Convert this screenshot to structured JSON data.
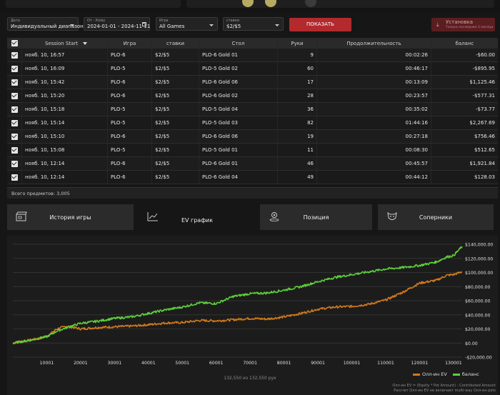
{
  "colors": {
    "ev": "#d17a1a",
    "balance": "#5ed03a",
    "accent_red": "#b22a2d"
  },
  "filters": {
    "date": {
      "label": "Дата",
      "value": "Индивидуальный диапазон"
    },
    "range": {
      "label": "От - Кому",
      "value": "2024-01-01 - 2024-11-11"
    },
    "game": {
      "label": "Игра",
      "value": "All Games"
    },
    "stakes": {
      "label": "ставки",
      "value": "$2/$5"
    },
    "show_button": "ПОКАЗАТЬ",
    "install_button": {
      "title": "Установка",
      "subtitle": "Только последние 3 месяца"
    }
  },
  "table": {
    "headers": [
      "Session Start",
      "Игра",
      "ставки",
      "Стол",
      "Руки",
      "Продолжительность",
      "баланс"
    ],
    "rows": [
      [
        "нояб. 10, 16:57",
        "PLO-6",
        "$2/$5",
        "PLO-6 Gold 01",
        "9",
        "00:02:26",
        "-$60.00"
      ],
      [
        "нояб. 10, 16:09",
        "PLO-5",
        "$2/$5",
        "PLO-5 Gold 02",
        "60",
        "00:46:17",
        "-$895.95"
      ],
      [
        "нояб. 10, 15:42",
        "PLO-6",
        "$2/$5",
        "PLO-6 Gold 06",
        "17",
        "00:13:09",
        "$1,125.46"
      ],
      [
        "нояб. 10, 15:20",
        "PLO-6",
        "$2/$5",
        "PLO-6 Gold 02",
        "28",
        "00:23:57",
        "-$577.31"
      ],
      [
        "нояб. 10, 15:18",
        "PLO-5",
        "$2/$5",
        "PLO-5 Gold 04",
        "36",
        "00:35:02",
        "-$73.77"
      ],
      [
        "нояб. 10, 15:14",
        "PLO-5",
        "$2/$5",
        "PLO-5 Gold 03",
        "82",
        "01:44:16",
        "$2,267.69"
      ],
      [
        "нояб. 10, 15:10",
        "PLO-6",
        "$2/$5",
        "PLO-6 Gold 06",
        "19",
        "00:27:18",
        "$756.46"
      ],
      [
        "нояб. 10, 15:08",
        "PLO-5",
        "$2/$5",
        "PLO-5 Gold 01",
        "11",
        "00:08:30",
        "$512.65"
      ],
      [
        "нояб. 10, 12:14",
        "PLO-6",
        "$2/$5",
        "PLO-6 Gold 01",
        "46",
        "00:45:57",
        "$1,921.84"
      ],
      [
        "нояб. 10, 12:14",
        "PLO-6",
        "$2/$5",
        "PLO-6 Gold 04",
        "49",
        "00:44:12",
        "$128.03"
      ]
    ],
    "total": "Всего предметов: 3,005"
  },
  "tabs": [
    {
      "label": "История игры",
      "icon": "clapperboard-icon"
    },
    {
      "label": "EV график",
      "icon": "line-chart-icon",
      "active": true
    },
    {
      "label": "Позиция",
      "icon": "position-pin-icon"
    },
    {
      "label": "Соперники",
      "icon": "opponent-face-icon"
    }
  ],
  "chart_data": {
    "type": "line",
    "x_range": [
      1,
      132550
    ],
    "x_ticks": [
      10001,
      20001,
      30001,
      40001,
      50001,
      60001,
      70001,
      80001,
      90001,
      100001,
      110001,
      120001,
      130001
    ],
    "ylim": [
      -20000,
      140000
    ],
    "y_ticks": [
      -20000,
      0,
      20000,
      40000,
      60000,
      80000,
      100000,
      120000,
      140000
    ],
    "y_tick_labels": [
      "-$20,000.00",
      "$0.00",
      "$20,000.00",
      "$40,000.00",
      "$60,000.00",
      "$80,000.00",
      "$100,000.00",
      "$120,000.00",
      "$140,000.00"
    ],
    "grid": true,
    "legend_position": "bottom-right",
    "series": [
      {
        "name": "Олл-ин EV",
        "color": "#d17a1a",
        "points": [
          [
            1,
            0
          ],
          [
            5000,
            4000
          ],
          [
            10000,
            9000
          ],
          [
            13000,
            20000
          ],
          [
            16000,
            24000
          ],
          [
            20000,
            20000
          ],
          [
            25000,
            22000
          ],
          [
            30000,
            23000
          ],
          [
            35000,
            24000
          ],
          [
            40000,
            26000
          ],
          [
            45000,
            28500
          ],
          [
            50000,
            29000
          ],
          [
            55000,
            32000
          ],
          [
            60000,
            31500
          ],
          [
            65000,
            33000
          ],
          [
            70000,
            35000
          ],
          [
            75000,
            34000
          ],
          [
            80000,
            37000
          ],
          [
            85000,
            42000
          ],
          [
            90000,
            48000
          ],
          [
            95000,
            51000
          ],
          [
            100000,
            52000
          ],
          [
            105000,
            55000
          ],
          [
            110000,
            61000
          ],
          [
            115000,
            72000
          ],
          [
            120000,
            85000
          ],
          [
            125000,
            89000
          ],
          [
            128000,
            96000
          ],
          [
            130000,
            97000
          ],
          [
            132550,
            101000
          ]
        ]
      },
      {
        "name": "баланс",
        "color": "#5ed03a",
        "points": [
          [
            1,
            0
          ],
          [
            5000,
            4000
          ],
          [
            10000,
            9000
          ],
          [
            13000,
            17000
          ],
          [
            16000,
            22000
          ],
          [
            20000,
            28000
          ],
          [
            25000,
            31000
          ],
          [
            30000,
            35000
          ],
          [
            35000,
            37000
          ],
          [
            40000,
            42000
          ],
          [
            45000,
            47000
          ],
          [
            50000,
            51000
          ],
          [
            55000,
            57000
          ],
          [
            60000,
            56000
          ],
          [
            65000,
            66000
          ],
          [
            70000,
            70000
          ],
          [
            75000,
            71000
          ],
          [
            80000,
            75000
          ],
          [
            85000,
            80000
          ],
          [
            90000,
            87000
          ],
          [
            95000,
            93000
          ],
          [
            100000,
            97000
          ],
          [
            105000,
            101000
          ],
          [
            110000,
            105000
          ],
          [
            115000,
            107000
          ],
          [
            120000,
            110000
          ],
          [
            125000,
            115000
          ],
          [
            128000,
            122000
          ],
          [
            130000,
            124000
          ],
          [
            132550,
            137000
          ]
        ]
      }
    ]
  },
  "chart_footer": {
    "counter": "132,550 из 132,550 рук",
    "legend_ev": "Олл-ин EV",
    "legend_balance": "баланс",
    "note_line1": "Олл-ин EV = (Equity * Pot Amount) - Contributed Amount",
    "note_line2": "Рассчет Олл-ин EV не включает multi-way Олл-ин pots"
  }
}
